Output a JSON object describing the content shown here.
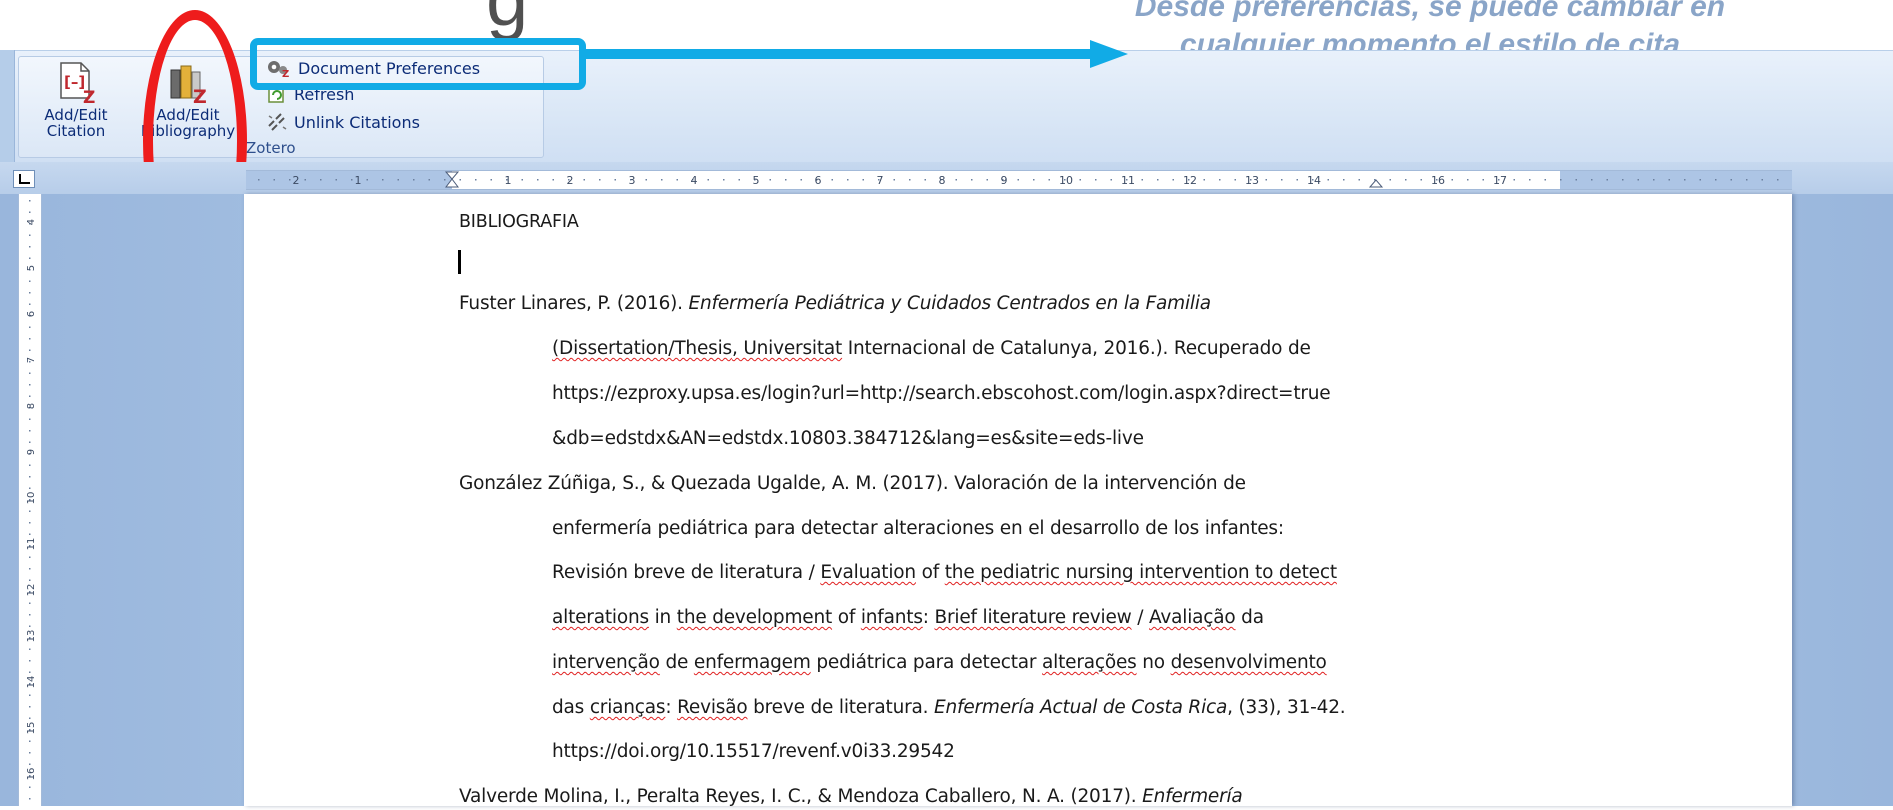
{
  "annotation": {
    "partial_letter": "g",
    "line1": "Desde preferencias, se puede cambiar en",
    "line2": "cualquier momento el estilo de cita",
    "highlight_color": "#11abe6",
    "oval_color": "#ee1c1c"
  },
  "ribbon": {
    "add_edit_citation": {
      "line1": "Add/Edit",
      "line2": "Citation",
      "icon": "add-citation-icon"
    },
    "add_edit_bibliography": {
      "line1": "Add/Edit",
      "line2": "Bibliography",
      "icon": "add-bibliography-icon"
    },
    "document_preferences": {
      "label": "Document Preferences",
      "icon": "gears-icon"
    },
    "refresh": {
      "label": "Refresh",
      "icon": "refresh-icon"
    },
    "unlink_citations": {
      "label": "Unlink Citations",
      "icon": "unlink-icon"
    },
    "group_label": "Zotero"
  },
  "rulers": {
    "horizontal_labels": [
      "2",
      "1",
      "1",
      "2",
      "3",
      "4",
      "5",
      "6",
      "7",
      "8",
      "9",
      "10",
      "11",
      "12",
      "13",
      "14",
      "16",
      "17"
    ],
    "vertical_labels": [
      "4",
      "5",
      "6",
      "7",
      "8",
      "9",
      "10",
      "11",
      "12",
      "13",
      "14",
      "15",
      "16"
    ]
  },
  "document": {
    "heading": "BIBLIOGRAFIA",
    "entry1": {
      "line1_plain": "Fuster Linares, P. (2016). ",
      "line1_italic": "Enfermería Pediátrica y Cuidados Centrados en la Familia",
      "line2_a": "(Dissertation/Thesis",
      "line2_b": ", Universitat",
      "line2_c": " Internacional de Catalunya, 2016.). Recuperado de",
      "line3": "https://ezproxy.upsa.es/login?url=http://search.ebscohost.com/login.aspx?direct=true",
      "line4": "&db=edstdx&AN=edstdx.10803.384712&lang=es&site=eds-live"
    },
    "entry2": {
      "line1": "González Zúñiga, S., & Quezada Ugalde, A. M. (2017). Valoración de la intervención de",
      "line2": "enfermería pediátrica para detectar alteraciones en el desarrollo de los infantes:",
      "line3_a": "Revisión breve de literatura / ",
      "line3_b": "Evaluation",
      "line3_c": " of ",
      "line3_d": "the pediatric nursing intervention to detect",
      "line4_a": "alterations",
      "line4_b": " in ",
      "line4_c": "the development",
      "line4_d": " of ",
      "line4_e": "infants",
      "line4_f": ": ",
      "line4_g": "Brief literature review",
      "line4_h": " / ",
      "line4_i": "Avaliação",
      "line4_j": " da",
      "line5_a": "intervenção",
      "line5_b": " de ",
      "line5_c": "enfermagem",
      "line5_d": " pediátrica para detectar ",
      "line5_e": "alterações",
      "line5_f": " no ",
      "line5_g": "desenvolvimento",
      "line6_a": "das ",
      "line6_b": "crianças",
      "line6_c": ": ",
      "line6_d": "Revisão",
      "line6_e": " breve de literatura. ",
      "line6_italic": "Enfermería Actual de Costa Rica",
      "line6_f": ", (33), 31-42.",
      "line7": "https://doi.org/10.15517/revenf.v0i33.29542"
    },
    "entry3": {
      "line1_plain": "Valverde Molina, I., Peralta Reyes, I. C., & Mendoza Caballero, N. A. (2017). ",
      "line1_italic": "Enfermería"
    }
  }
}
